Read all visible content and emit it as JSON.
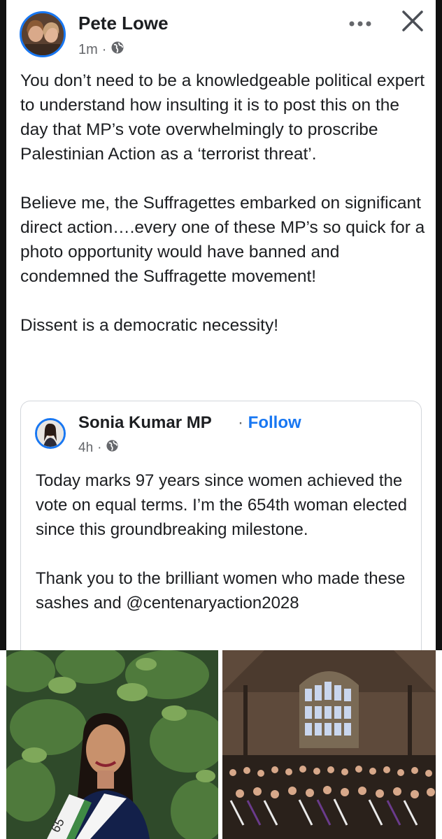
{
  "post": {
    "author": "Pete Lowe",
    "time": "1m",
    "separator": "·",
    "privacy_icon": "globe-icon",
    "paragraphs": [
      "You don’t need to be a knowledgeable political expert to understand how insulting it is to post this on the day that MP’s vote overwhelmingly to proscribe Palestinian Action as a ‘terrorist threat’.",
      "Believe me, the Suffragettes embarked on significant direct action….every one of these MP’s so quick for a photo opportunity would have banned and condemned the Suffragette movement!",
      "Dissent is a democratic necessity!"
    ]
  },
  "header_actions": {
    "more_icon": "more-dots-icon",
    "close_icon": "close-icon"
  },
  "shared": {
    "author": "Sonia Kumar MP",
    "separator": "·",
    "follow_label": "Follow",
    "time": "4h",
    "paragraphs": [
      "Today marks 97 years since women achieved the vote on equal terms. I’m the 654th woman elected since this groundbreaking milestone.",
      "Thank you to the brilliant women who made these sashes and @centenaryaction2028"
    ],
    "sash_text": "65"
  },
  "colors": {
    "accent": "#1877f2",
    "meta": "#65676b",
    "text": "#1c1e21",
    "frame": "#111111"
  }
}
